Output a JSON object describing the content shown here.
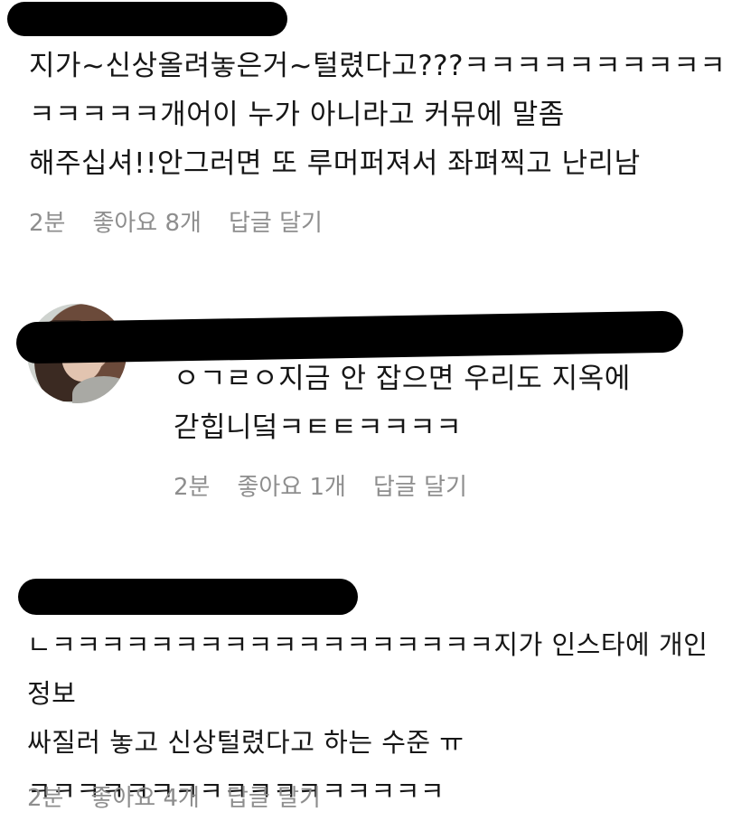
{
  "comments": [
    {
      "lines": [
        "지가~신상올려놓은거~털렸다고???ㅋㅋㅋㅋㅋㅋㅋㅋㅋㅋ",
        "ㅋㅋㅋㅋㅋ개어이 누가 아니라고 커뮤에 말좀",
        "해주십셔!!안그러면 또 루머퍼져서 좌펴찍고 난리남"
      ],
      "time": "2분",
      "likes": "좋아요 8개",
      "reply": "답글 달기"
    },
    {
      "lines": [
        "ㅇㄱㄹㅇ지금 안 잡으면 우리도 지옥에",
        "갇힙니덬ㅋㅌㅌㅋㅋㅋㅋ"
      ],
      "time": "2분",
      "likes": "좋아요 1개",
      "reply": "답글 달기"
    },
    {
      "lines": [
        "ㄴㅋㅋㅋㅋㅋㅋㅋㅋㅋㅋㅋㅋㅋㅋㅋㅋㅋㅋ지가 인스타에 개인정보",
        "싸질러 놓고 신상털렸다고 하는 수준 ㅠ",
        "ㅋㅋㅋㅋㅋㅋㅋㅋㅋㅋㅋㅋㅋㅋㅋㅋㅋ"
      ],
      "time": "2분",
      "likes": "좋아요 4개",
      "reply": "답글 달기"
    }
  ]
}
